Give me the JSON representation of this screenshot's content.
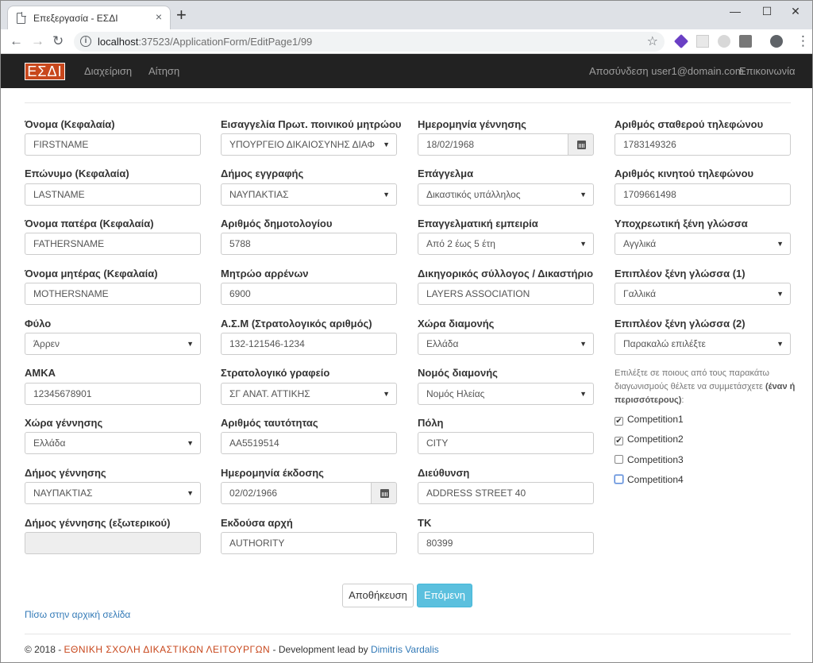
{
  "browser": {
    "tab_title": "Επεξεργασία - ΕΣΔΙ",
    "tab_close": "×",
    "new_tab": "+",
    "minimize": "—",
    "maximize": "☐",
    "close": "✕",
    "back": "←",
    "forward": "→",
    "reload": "↻",
    "url_host": "localhost",
    "url_path": ":37523/ApplicationForm/EditPage1/99",
    "star": "☆",
    "profile": "●",
    "menu": "⋮"
  },
  "navbar": {
    "brand": "ΕΣΔΙ",
    "brand_color": "#c8471c",
    "links": [
      "Διαχείριση",
      "Αίτηση"
    ],
    "logout": "Αποσύνδεση user1@domain.com",
    "contact": "Επικοινωνία"
  },
  "form": {
    "col1": [
      {
        "label": "Όνομα (Κεφαλαία)",
        "value": "FIRSTNAME",
        "kind": "input"
      },
      {
        "label": "Επώνυμο (Κεφαλαία)",
        "value": "LASTNAME",
        "kind": "input"
      },
      {
        "label": "Όνομα πατέρα (Κεφαλαία)",
        "value": "FATHERSNAME",
        "kind": "input"
      },
      {
        "label": "Όνομα μητέρας (Κεφαλαία)",
        "value": "MOTHERSNAME",
        "kind": "input"
      },
      {
        "label": "Φύλο",
        "value": "Άρρεν",
        "kind": "select"
      },
      {
        "label": "ΑΜΚΑ",
        "value": "12345678901",
        "kind": "input"
      },
      {
        "label": "Χώρα γέννησης",
        "value": "Ελλάδα",
        "kind": "select"
      },
      {
        "label": "Δήμος γέννησης",
        "value": "ΝΑΥΠΑΚΤΙΑΣ",
        "kind": "select"
      },
      {
        "label": "Δήμος γέννησης (εξωτερικού)",
        "value": "",
        "kind": "disabled"
      }
    ],
    "col2": [
      {
        "label": "Εισαγγελία Πρωτ. ποινικού μητρώου",
        "value": "ΥΠΟΥΡΓΕΙΟ ΔΙΚΑΙΟΣΥΝΗΣ ΔΙΑΦ",
        "kind": "select"
      },
      {
        "label": "Δήμος εγγραφής",
        "value": "ΝΑΥΠΑΚΤΙΑΣ",
        "kind": "select"
      },
      {
        "label": "Αριθμός δημοτολογίου",
        "value": "5788",
        "kind": "input"
      },
      {
        "label": "Μητρώο αρρένων",
        "value": "6900",
        "kind": "input"
      },
      {
        "label": "Α.Σ.Μ (Στρατολογικός αριθμός)",
        "value": "132-121546-1234",
        "kind": "input"
      },
      {
        "label": "Στρατολογικό γραφείο",
        "value": "ΣΓ ΑΝΑΤ. ΑΤΤΙΚΗΣ",
        "kind": "select"
      },
      {
        "label": "Αριθμός ταυτότητας",
        "value": "ΑΑ5519514",
        "kind": "input"
      },
      {
        "label": "Ημερομηνία έκδοσης",
        "value": "02/02/1966",
        "kind": "date"
      },
      {
        "label": "Εκδούσα αρχή",
        "value": "AUTHORITY",
        "kind": "input"
      }
    ],
    "col3": [
      {
        "label": "Ημερομηνία γέννησης",
        "value": "18/02/1968",
        "kind": "date"
      },
      {
        "label": "Επάγγελμα",
        "value": "Δικαστικός υπάλληλος",
        "kind": "select"
      },
      {
        "label": "Επαγγελματική εμπειρία",
        "value": "Από 2 έως 5 έτη",
        "kind": "select"
      },
      {
        "label": "Δικηγορικός σύλλογος / Δικαστήριο",
        "value": "LAYERS ASSOCIATION",
        "kind": "input"
      },
      {
        "label": "Χώρα διαμονής",
        "value": "Ελλάδα",
        "kind": "select"
      },
      {
        "label": "Νομός διαμονής",
        "value": "Νομός Ηλείας",
        "kind": "select"
      },
      {
        "label": "Πόλη",
        "value": "CITY",
        "kind": "input"
      },
      {
        "label": "Διεύθυνση",
        "value": "ADDRESS STREET 40",
        "kind": "input"
      },
      {
        "label": "ΤΚ",
        "value": "80399",
        "kind": "input"
      }
    ],
    "col4": [
      {
        "label": "Αριθμός σταθερού τηλεφώνου",
        "value": "1783149326",
        "kind": "input"
      },
      {
        "label": "Αριθμός κινητού τηλεφώνου",
        "value": "1709661498",
        "kind": "input"
      },
      {
        "label": "Υποχρεωτική ξένη γλώσσα",
        "value": "Αγγλικά",
        "kind": "select"
      },
      {
        "label": "Επιπλέον ξένη γλώσσα (1)",
        "value": "Γαλλικά",
        "kind": "select"
      },
      {
        "label": "Επιπλέον ξένη γλώσσα (2)",
        "value": "Παρακαλώ επιλέξτε",
        "kind": "select"
      }
    ],
    "competitions_hint": "Επιλέξτε σε ποιους από τους παρακάτω διαγωνισμούς θέλετε να συμμετάσχετε",
    "competitions_hint_bold": "(έναν ή περισσότερους)",
    "competitions_hint_tail": ":",
    "competitions": [
      {
        "label": "Competition1",
        "checked": true
      },
      {
        "label": "Competition2",
        "checked": true
      },
      {
        "label": "Competition3",
        "checked": false
      },
      {
        "label": "Competition4",
        "checked": false
      }
    ],
    "save_label": "Αποθήκευση",
    "next_label": "Επόμενη",
    "back_link": "Πίσω στην αρχική σελίδα"
  },
  "footer": {
    "prefix": "© 2018 -",
    "school": "ΕΘΝΙΚΗ ΣΧΟΛΗ ΔΙΚΑΣΤΙΚΩΝ ΛΕΙΤΟΥΡΓΩΝ",
    "dev_text": "- Development lead by",
    "dev_name": "Dimitris Vardalis"
  }
}
